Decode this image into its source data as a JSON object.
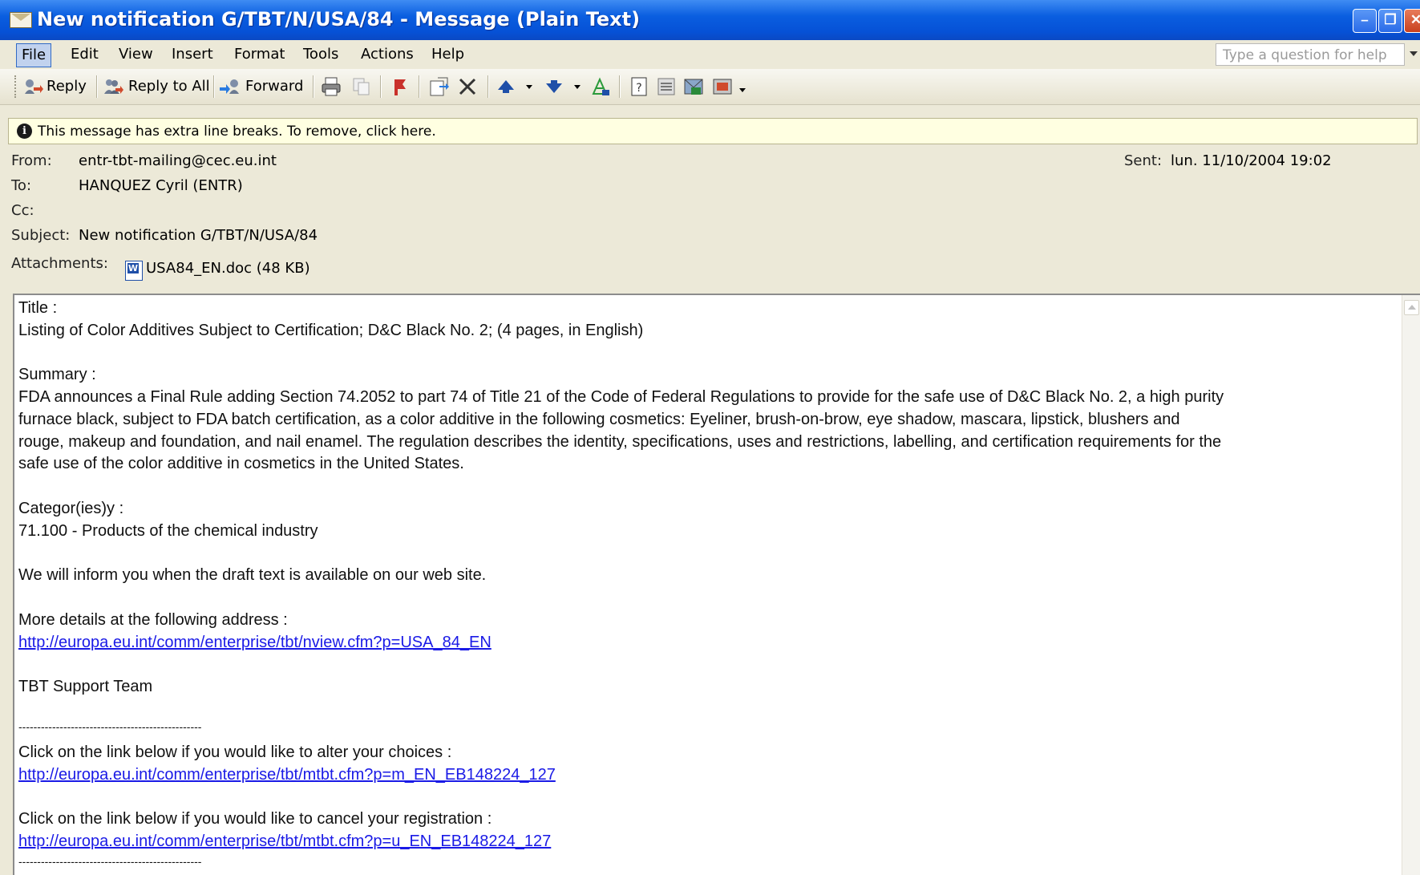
{
  "window": {
    "title": "New notification G/TBT/N/USA/84 - Message (Plain Text)",
    "minimize_glyph": "–",
    "restore_glyph": "❐",
    "close_glyph": "✕"
  },
  "menu": {
    "items": [
      "File",
      "Edit",
      "View",
      "Insert",
      "Format",
      "Tools",
      "Actions",
      "Help"
    ],
    "help_placeholder": "Type a question for help"
  },
  "toolbar": {
    "reply": "Reply",
    "reply_all": "Reply to All",
    "forward": "Forward",
    "icons": [
      "print-icon",
      "copy-icon",
      "flag-icon",
      "move-to-folder-icon",
      "delete-icon",
      "previous-item-icon",
      "next-item-icon",
      "address-book-icon",
      "help-icon",
      "options-icon",
      "envelope-icon",
      "view-icon"
    ]
  },
  "infobar": {
    "text": "This message has extra line breaks. To remove, click here."
  },
  "header": {
    "from_label": "From:",
    "from_value": "entr-tbt-mailing@cec.eu.int",
    "to_label": "To:",
    "to_value": "HANQUEZ Cyril (ENTR)",
    "cc_label": "Cc:",
    "cc_value": "",
    "subject_label": "Subject:",
    "subject_value": "New notification G/TBT/N/USA/84",
    "attachments_label": "Attachments:",
    "attachment_file": "USA84_EN.doc (48 KB)",
    "sent_label": "Sent:",
    "sent_value": "lun. 11/10/2004 19:02"
  },
  "body": {
    "title_label": "Title :",
    "title_text": "Listing of Color Additives Subject to Certification;  D&C Black No. 2; (4 pages, in English)",
    "summary_label": "Summary :",
    "summary_lines": [
      "FDA announces a Final Rule adding Section 74.2052 to  part 74 of Title 21 of the Code of Federal Regulations to provide for the safe use of D&C Black No. 2, a high purity",
      "furnace black, subject to FDA batch certification, as a color additive in the following cosmetics:  Eyeliner, brush-on-brow, eye shadow, mascara, lipstick, blushers and",
      "rouge, makeup and foundation, and nail enamel.  The regulation describes the identity, specifications, uses and restrictions, labelling, and certification requirements for the",
      "safe use of the color additive in cosmetics in the United States."
    ],
    "category_label": "Categor(ies)y :",
    "category_text": "71.100 - Products of the chemical industry",
    "inform_text": "We will inform you when the draft text is available on our web site.",
    "details_label": "More details at the following address :",
    "details_link": "http://europa.eu.int/comm/enterprise/tbt/nview.cfm?p=USA_84_EN",
    "team": "TBT Support Team",
    "separator": "-------------------------------------------------",
    "alter_text": "Click on the link below if you would like to alter your choices :",
    "alter_link": "http://europa.eu.int/comm/enterprise/tbt/mtbt.cfm?p=m_EN_EB148224_127",
    "cancel_text": "Click on the link below if you would like to cancel your registration :",
    "cancel_link": "http://europa.eu.int/comm/enterprise/tbt/mtbt.cfm?p=u_EN_EB148224_127",
    "separator2": "-------------------------------------------------"
  }
}
